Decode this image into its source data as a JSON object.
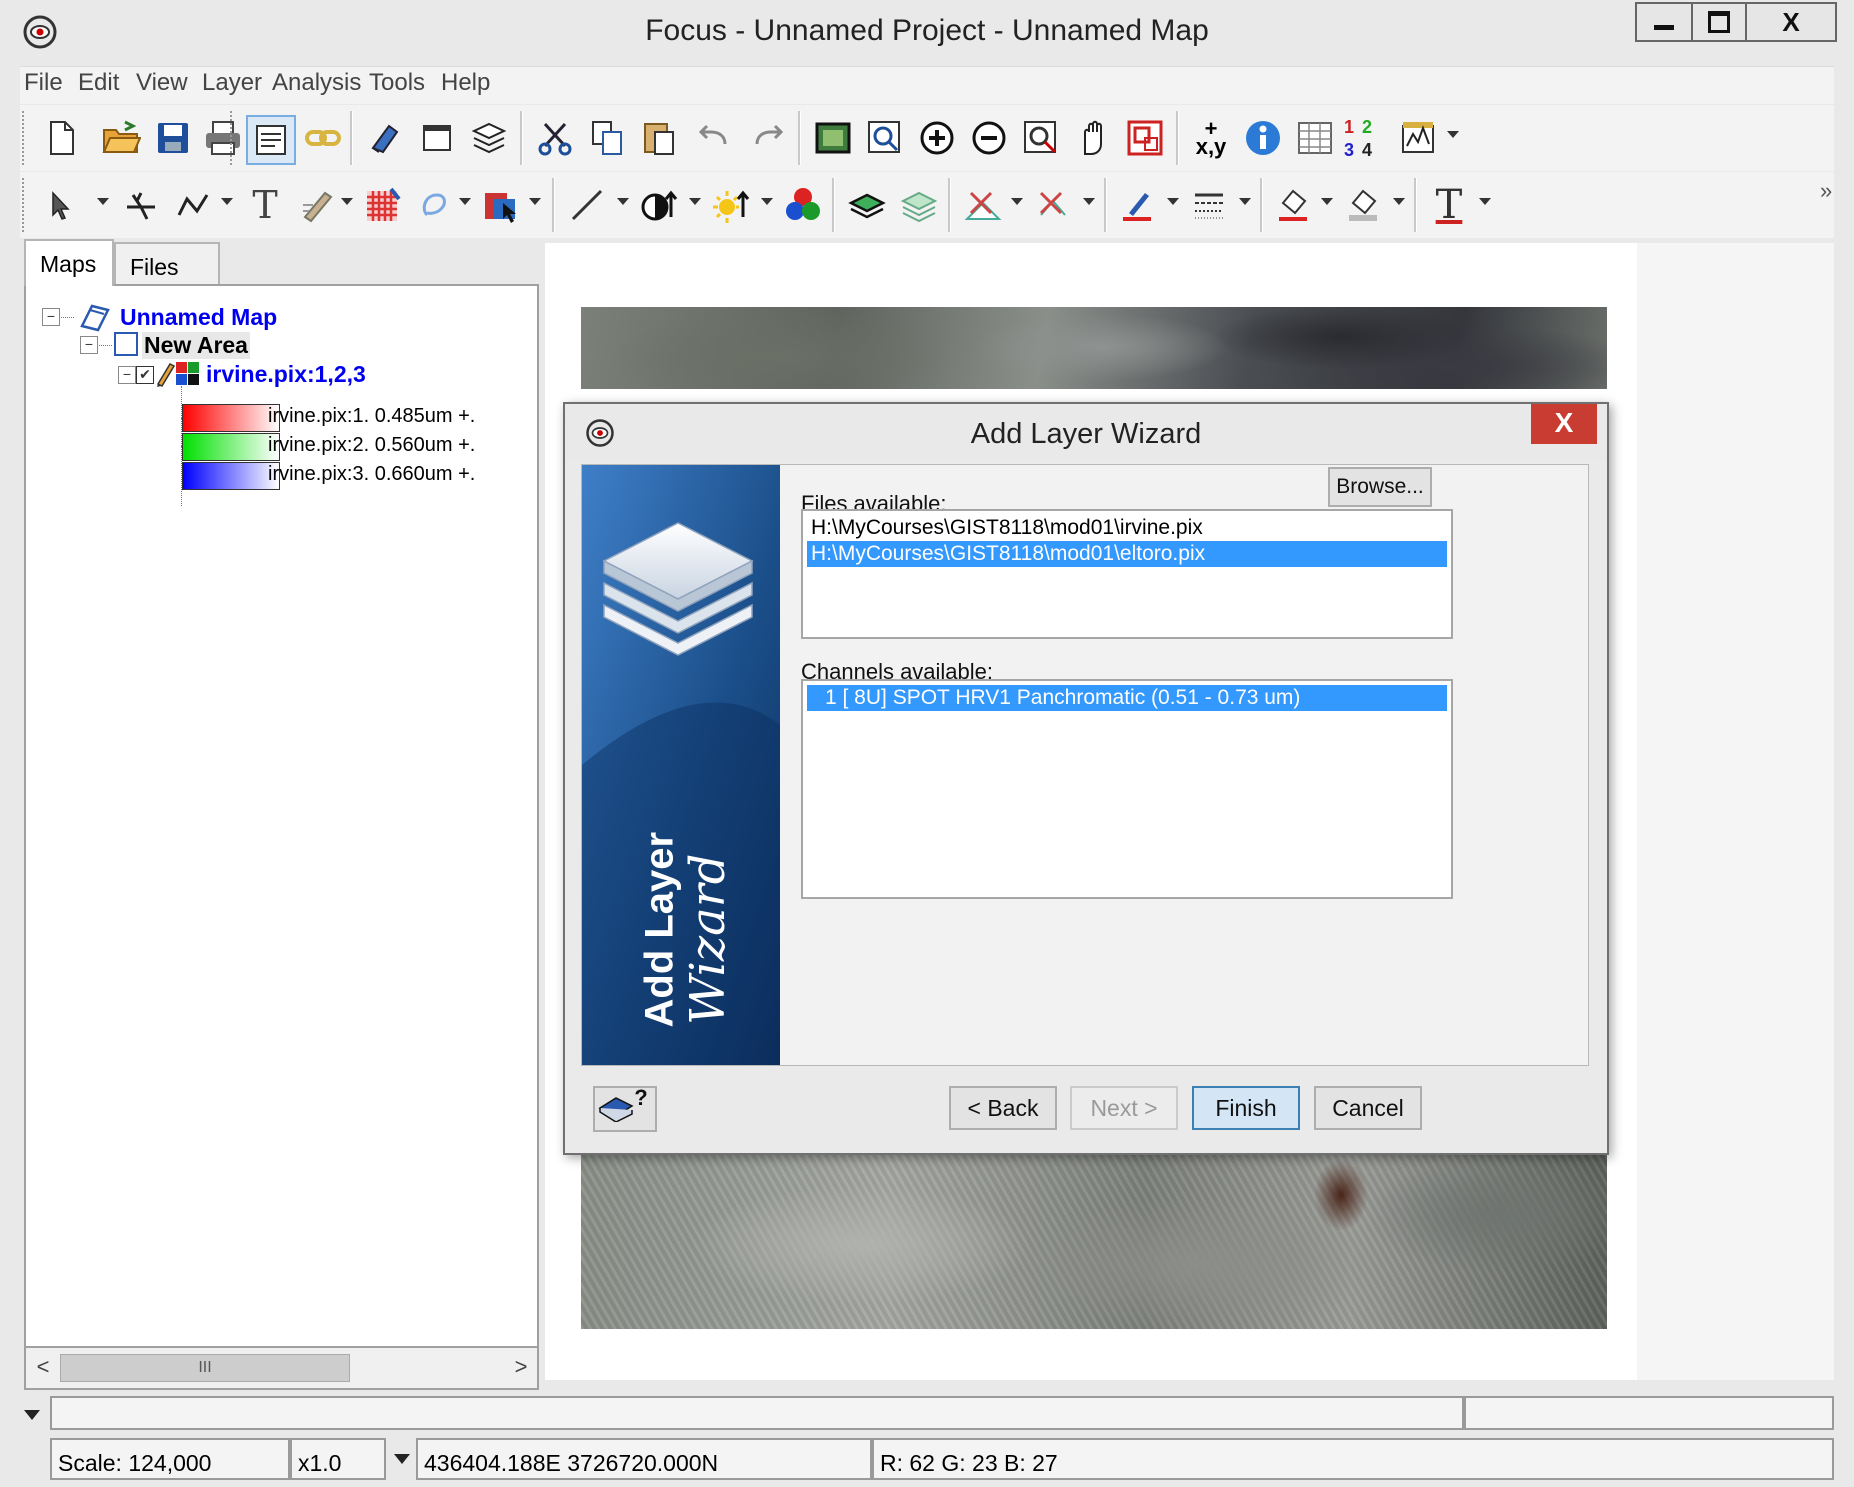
{
  "window": {
    "title": "Focus - Unnamed Project - Unnamed Map",
    "controls": {
      "minimize": "−",
      "maximize": "□",
      "close": "X"
    }
  },
  "menu": [
    "File",
    "Edit",
    "View",
    "Layer",
    "Analysis",
    "Tools",
    "Help"
  ],
  "toolbar1_icons": [
    "new-file-icon",
    "open-folder-icon",
    "save-icon",
    "print-icon",
    "properties-icon",
    "link-icon",
    "eraser-icon",
    "window-icon",
    "layers-icon",
    "cut-icon",
    "copy-icon",
    "paste-icon",
    "undo-icon",
    "redo-icon",
    "zoom-extent-icon",
    "zoom-window-icon",
    "zoom-in-icon",
    "zoom-out-icon",
    "zoom-selection-icon",
    "pan-hand-icon",
    "overview-icon",
    "xy-coordinate-icon",
    "info-icon",
    "table-icon",
    "numbers-icon",
    "chart-icon"
  ],
  "toolbar1_text": {
    "xy": "x,y",
    "xy_plus": "+",
    "n1": "1",
    "n2": "2",
    "n3": "3",
    "n4": "4"
  },
  "toolbar2_icons": [
    "select-arrow-icon",
    "vertex-edit-icon",
    "polyline-icon",
    "text-tool-icon",
    "reshape-icon",
    "raster-grid-icon",
    "lasso-icon",
    "classify-icon",
    "line-icon",
    "contrast-icon",
    "brightness-icon",
    "rgb-icon",
    "layer-stack-icon",
    "layer-merge-icon",
    "vector-split-icon",
    "vector-join-icon",
    "pen-color-icon",
    "line-style-icon",
    "fill-color-icon",
    "fill-pattern-icon",
    "font-icon"
  ],
  "toolbar2_text": {
    "text_tool": "T",
    "font": "T",
    "more": "»"
  },
  "tabs": {
    "maps": "Maps",
    "files": "Files"
  },
  "tree": {
    "map": "Unnamed Map",
    "area": "New Area",
    "layer": "irvine.pix:1,2,3",
    "channels": [
      {
        "label": "irvine.pix:1. 0.485um +.",
        "color": "#ff0000"
      },
      {
        "label": "irvine.pix:2. 0.560um +.",
        "color": "#00e000"
      },
      {
        "label": "irvine.pix:3. 0.660um +.",
        "color": "#0000ff"
      }
    ],
    "expand_glyph": "⊟",
    "collapse_glyph": "−",
    "check_glyph": "✔"
  },
  "scrollbar": {
    "left": "<",
    "right": ">",
    "thumb": "III"
  },
  "dialog": {
    "title": "Add Layer Wizard",
    "close": "X",
    "banner_line1": "Add Layer",
    "banner_line2": "Wizard",
    "files_label": "Files available:",
    "browse": "Browse...",
    "files": [
      {
        "path": "H:\\MyCourses\\GIST8118\\mod01\\irvine.pix",
        "selected": false
      },
      {
        "path": "H:\\MyCourses\\GIST8118\\mod01\\eltoro.pix",
        "selected": true
      }
    ],
    "channels_label": "Channels available:",
    "channels": [
      {
        "text": "1 [ 8U] SPOT HRV1 Panchromatic (0.51 - 0.73 um)",
        "selected": true
      }
    ],
    "buttons": {
      "back": "< Back",
      "next": "Next >",
      "finish": "Finish",
      "cancel": "Cancel"
    },
    "help_glyph": "?"
  },
  "status": {
    "scale": "Scale: 124,000",
    "zoom": "x1.0",
    "coords": "436404.188E 3726720.000N",
    "rgb": "R: 62 G: 23 B: 27"
  },
  "colors": {
    "selection": "#3399ff",
    "tree_link": "#0000ee",
    "close_red": "#c83c31",
    "banner_blue": "#1b4f8a"
  }
}
